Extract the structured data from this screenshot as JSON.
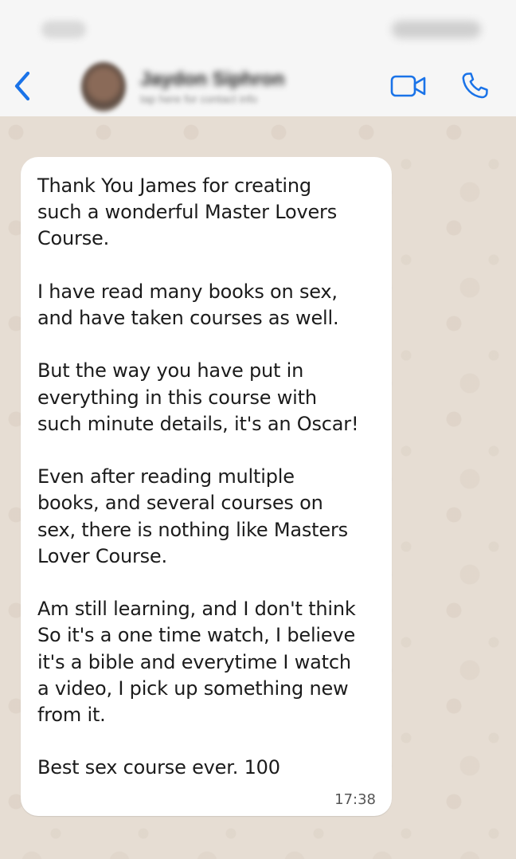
{
  "status_bar": {
    "time": "",
    "indicators": ""
  },
  "header": {
    "back_icon": "chevron-left-icon",
    "contact_name": "Jaydon Siphron",
    "contact_subtitle": "tap here for contact info",
    "video_icon": "video-camera-icon",
    "call_icon": "phone-icon",
    "accent_color": "#1a73e8"
  },
  "message": {
    "paragraphs": [
      "Thank You James for creating\nsuch a wonderful Master Lovers\nCourse.",
      "I have read many books on sex,\nand have taken courses as well.",
      "But the way you have put in\neverything in this course with\nsuch minute details, it's an Oscar!",
      "Even after reading multiple\nbooks, and several courses on\nsex, there is nothing like Masters\nLover Course.",
      "Am still learning, and I don't think\nSo it's a one time watch, I believe\nit's a bible and everytime I watch\na video, I pick up something new\nfrom it.",
      "Best sex course ever. 100"
    ],
    "time": "17:38",
    "bubble_color": "#ffffff"
  },
  "chat": {
    "wallpaper_color": "#e6ddd3"
  }
}
